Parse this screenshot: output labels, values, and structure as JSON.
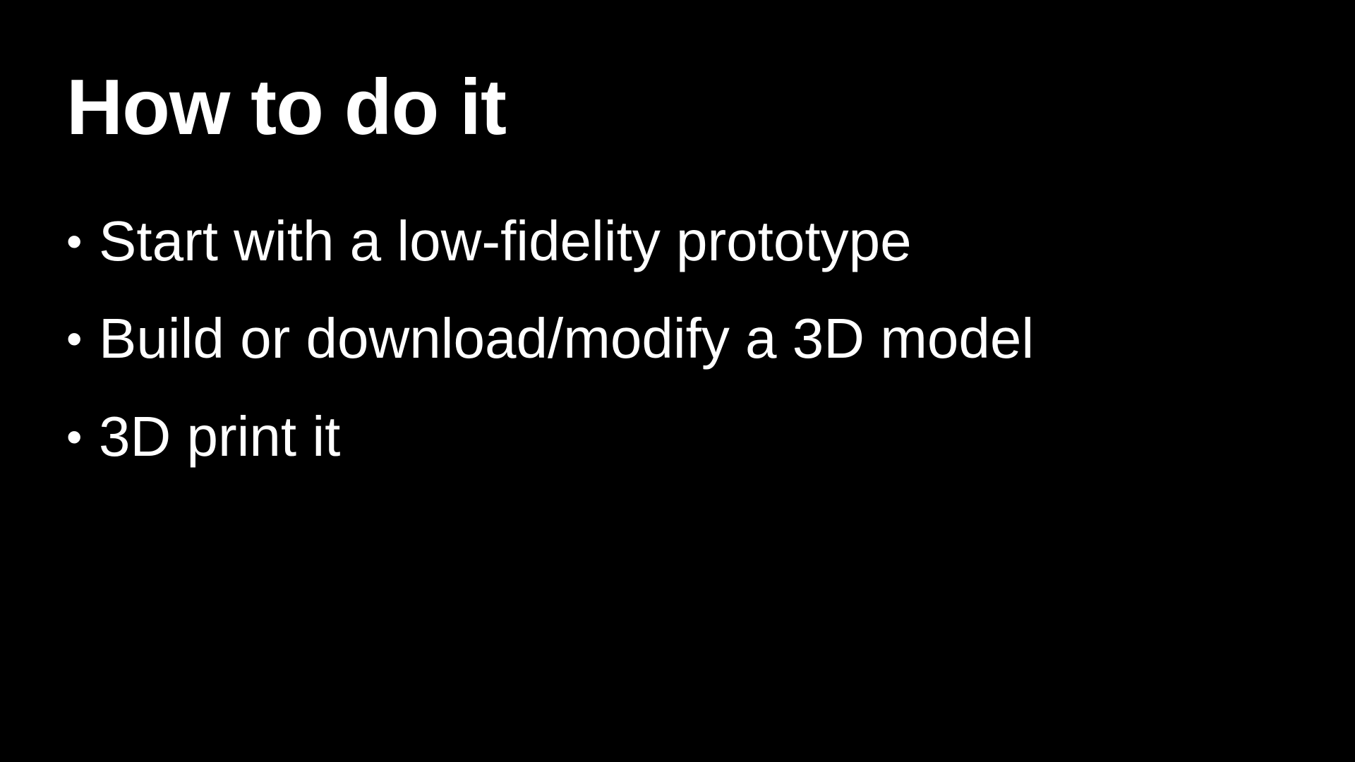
{
  "slide": {
    "title": "How to do it",
    "bullet_glyph": "•",
    "bullets": [
      "Start with a low-fidelity prototype",
      "Build or download/modify a 3D model",
      "3D print it"
    ],
    "colors": {
      "background": "#000000",
      "text": "#ffffff"
    }
  }
}
